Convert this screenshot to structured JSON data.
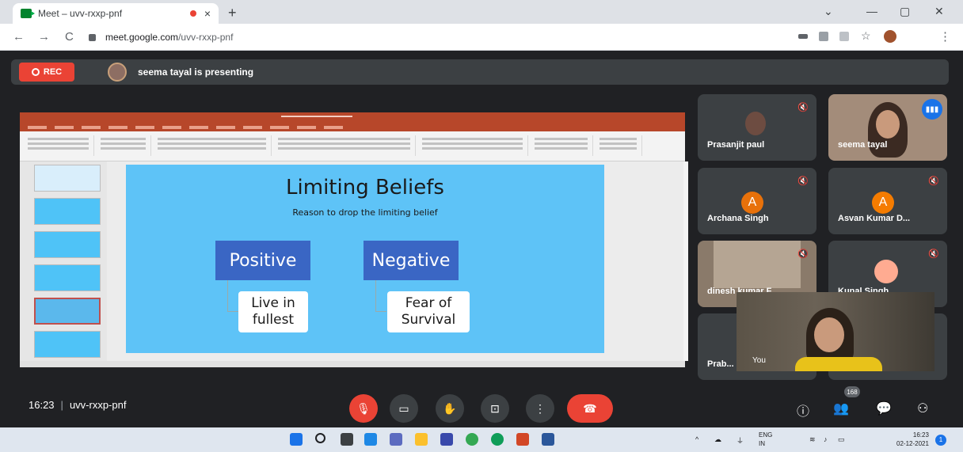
{
  "browser": {
    "tab_title": "Meet – uvv-rxxp-pnf",
    "tab_close": "×",
    "new_tab": "+",
    "url_host": "meet.google.com",
    "url_path": "/uvv-rxxp-pnf",
    "nav_back": "←",
    "nav_forward": "→",
    "nav_reload": "C",
    "win_min": "—",
    "win_max": "▢",
    "win_close": "✕",
    "win_chevron": "⌄",
    "menu": "⋮",
    "star": "☆"
  },
  "banner": {
    "rec_label": "REC",
    "presenting_text": "seema tayal is presenting"
  },
  "slide": {
    "title": "Limiting Beliefs",
    "subtitle": "Reason to drop the limiting belief",
    "left_header": "Positive",
    "right_header": "Negative",
    "left_item_line1": "Live in",
    "left_item_line2": "fullest",
    "right_item_line1": "Fear of",
    "right_item_line2": "Survival"
  },
  "participants": [
    {
      "name": "Prasanjit paul"
    },
    {
      "name": "seema tayal"
    },
    {
      "name": "Archana Singh",
      "initial": "A",
      "color": "#e8710a"
    },
    {
      "name": "Asvan Kumar D...",
      "initial": "A",
      "color": "#f57c00"
    },
    {
      "name": "dinesh kumar F..."
    },
    {
      "name": "Kunal Singh"
    },
    {
      "name": "Prab..."
    }
  ],
  "self_view": {
    "label": "You"
  },
  "bottom": {
    "time": "16:23",
    "separator": "|",
    "meeting_code": "uvv-rxxp-pnf",
    "participant_count": "168"
  },
  "taskbar": {
    "lang_line1": "ENG",
    "lang_line2": "IN",
    "time": "16:23",
    "date": "02-12-2021",
    "notification_count": "1"
  },
  "colors": {
    "rec_red": "#ea4335",
    "meet_bg": "#202124",
    "tile_bg": "#3c4043",
    "slide_bg": "#5ec3f7",
    "slide_box": "#3a66c4",
    "ppt_accent": "#b7472a"
  }
}
